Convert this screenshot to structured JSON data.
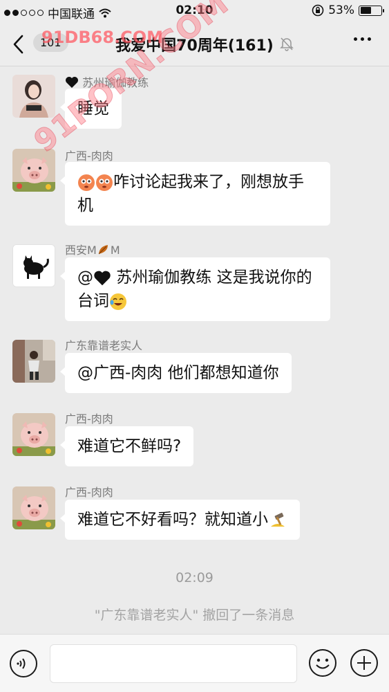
{
  "status_bar": {
    "carrier": "中国联通",
    "time": "02:10",
    "battery": "53%",
    "battery_level": 0.53
  },
  "nav": {
    "back_count": "101",
    "title": "我爱中国70周年(161)"
  },
  "messages": [
    {
      "sender": "苏州瑜伽教练",
      "text": "睡觉"
    },
    {
      "sender": "广西-肉肉",
      "text": "咋讨论起我来了，刚想放手机"
    },
    {
      "sender": "西安M",
      "sender_suffix": "M",
      "text_before": "@",
      "text_after": " 苏州瑜伽教练 这是我说你的台词"
    },
    {
      "sender": "广东靠谱老实人",
      "text": "@广西-肉肉 他们都想知道你"
    },
    {
      "sender": "广西-肉肉",
      "text": "难道它不鲜吗?"
    },
    {
      "sender": "广西-肉肉",
      "text": "难道它不好看吗？就知道小"
    }
  ],
  "time_separator": "02:09",
  "recall_notice": "\"广东靠谱老实人\" 撤回了一条消息",
  "watermark": {
    "top": "91DB68.COM",
    "diagonal": "91PORN.COM"
  },
  "colors": {
    "background": "#ebebeb",
    "bubble": "#ffffff",
    "meta_text": "#7a7a7a"
  }
}
